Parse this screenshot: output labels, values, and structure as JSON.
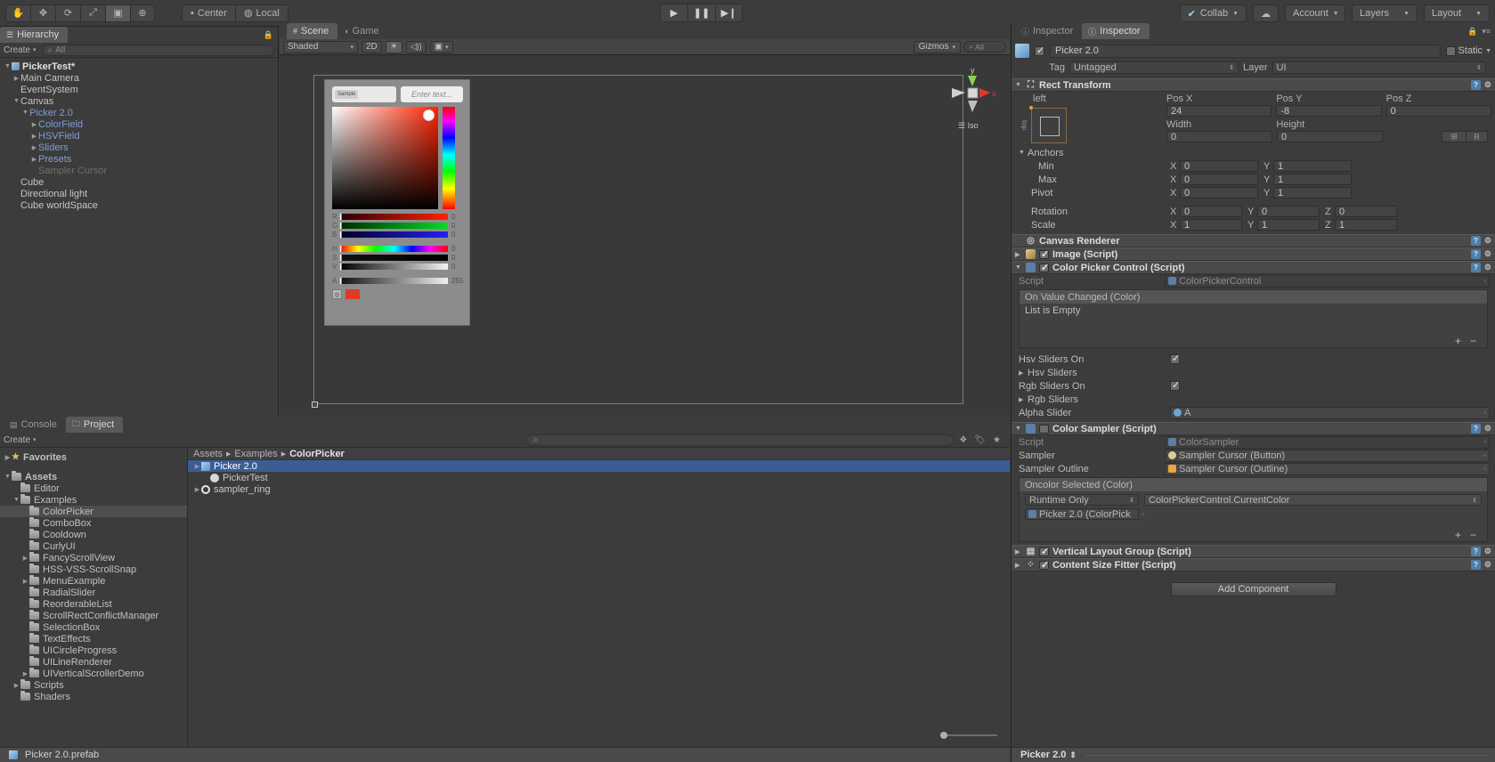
{
  "toolbar": {
    "tools": [
      {
        "name": "hand-tool",
        "glyph": "✋",
        "active": false
      },
      {
        "name": "move-tool",
        "glyph": "✥",
        "active": false
      },
      {
        "name": "rotate-tool",
        "glyph": "⟳",
        "active": false
      },
      {
        "name": "scale-tool",
        "glyph": "⤢",
        "active": false
      },
      {
        "name": "rect-tool",
        "glyph": "▣",
        "active": true
      },
      {
        "name": "transform-tool",
        "glyph": "⊕",
        "active": false
      }
    ],
    "pivot_label": "Center",
    "space_label": "Local",
    "play_label": "▶",
    "pause_label": "❚❚",
    "step_label": "▶❙",
    "collab_label": "Collab",
    "cloud_label": "☁",
    "account_label": "Account",
    "layers_label": "Layers",
    "layout_label": "Layout"
  },
  "hierarchy": {
    "tab_label": "Hierarchy",
    "create_label": "Create",
    "search_placeholder": "All",
    "items": [
      {
        "label": "PickerTest*",
        "depth": 0,
        "arrow": "down",
        "style": "root",
        "icon": "scene-icon"
      },
      {
        "label": "Main Camera",
        "depth": 1,
        "arrow": "right",
        "style": "normal",
        "icon": ""
      },
      {
        "label": "EventSystem",
        "depth": 1,
        "arrow": "none",
        "style": "normal",
        "icon": ""
      },
      {
        "label": "Canvas",
        "depth": 1,
        "arrow": "down",
        "style": "normal",
        "icon": ""
      },
      {
        "label": "Picker 2.0",
        "depth": 2,
        "arrow": "down",
        "style": "prefab",
        "icon": ""
      },
      {
        "label": "ColorField",
        "depth": 3,
        "arrow": "right",
        "style": "prefab",
        "icon": ""
      },
      {
        "label": "HSVField",
        "depth": 3,
        "arrow": "right",
        "style": "prefab",
        "icon": ""
      },
      {
        "label": "Sliders",
        "depth": 3,
        "arrow": "right",
        "style": "prefab",
        "icon": ""
      },
      {
        "label": "Presets",
        "depth": 3,
        "arrow": "right",
        "style": "prefab",
        "icon": ""
      },
      {
        "label": "Sampler Cursor",
        "depth": 3,
        "arrow": "none",
        "style": "faded",
        "icon": ""
      },
      {
        "label": "Cube",
        "depth": 1,
        "arrow": "none",
        "style": "normal",
        "icon": ""
      },
      {
        "label": "Directional light",
        "depth": 1,
        "arrow": "none",
        "style": "normal",
        "icon": ""
      },
      {
        "label": "Cube worldSpace",
        "depth": 1,
        "arrow": "none",
        "style": "normal",
        "icon": ""
      }
    ]
  },
  "scene": {
    "tab_scene": "Scene",
    "tab_game": "Game",
    "shading_mode": "Shaded",
    "mode_2d": "2D",
    "lighting_icon": "☀",
    "audio_icon": "🔊",
    "fx_icon": "▣",
    "gizmos_label": "Gizmos",
    "gizmo_search_placeholder": "All",
    "axis_labels": {
      "y": "y",
      "x": "x",
      "projection": "Iso"
    }
  },
  "picker": {
    "sample_label": "Sample",
    "input_placeholder": "Enter text...",
    "sliders": [
      {
        "label": "R",
        "value": "0",
        "track": "sld-r",
        "knob": 0
      },
      {
        "label": "G",
        "value": "0",
        "track": "sld-g",
        "knob": 0
      },
      {
        "label": "B",
        "value": "0",
        "track": "sld-b",
        "knob": 0
      },
      {
        "label": "H",
        "value": "0",
        "track": "sld-h",
        "knob": 0
      },
      {
        "label": "S",
        "value": "0",
        "track": "sld-s",
        "knob": 0
      },
      {
        "label": "V",
        "value": "0",
        "track": "sld-v",
        "knob": 0
      },
      {
        "label": "A",
        "value": "255",
        "track": "sld-a",
        "knob": 0
      }
    ],
    "swatch_color": "#e03a26"
  },
  "project": {
    "tab_console": "Console",
    "tab_project": "Project",
    "create_label": "Create",
    "breadcrumb": [
      "Assets",
      "Examples",
      "ColorPicker"
    ],
    "tree": [
      {
        "label": "Favorites",
        "depth": 0,
        "arrow": "right",
        "icon": "star",
        "bold": true,
        "selected": false
      },
      {
        "label": "",
        "depth": 0,
        "arrow": "none",
        "icon": "spacer",
        "bold": false,
        "selected": false
      },
      {
        "label": "Assets",
        "depth": 0,
        "arrow": "down",
        "icon": "folder",
        "bold": true,
        "selected": false
      },
      {
        "label": "Editor",
        "depth": 1,
        "arrow": "none",
        "icon": "folder",
        "bold": false,
        "selected": false
      },
      {
        "label": "Examples",
        "depth": 1,
        "arrow": "down",
        "icon": "folder",
        "bold": false,
        "selected": false
      },
      {
        "label": "ColorPicker",
        "depth": 2,
        "arrow": "none",
        "icon": "folder",
        "bold": false,
        "selected": true
      },
      {
        "label": "ComboBox",
        "depth": 2,
        "arrow": "none",
        "icon": "folder",
        "bold": false,
        "selected": false
      },
      {
        "label": "Cooldown",
        "depth": 2,
        "arrow": "none",
        "icon": "folder",
        "bold": false,
        "selected": false
      },
      {
        "label": "CurlyUI",
        "depth": 2,
        "arrow": "none",
        "icon": "folder",
        "bold": false,
        "selected": false
      },
      {
        "label": "FancyScrollView",
        "depth": 2,
        "arrow": "right",
        "icon": "folder",
        "bold": false,
        "selected": false
      },
      {
        "label": "HSS-VSS-ScrollSnap",
        "depth": 2,
        "arrow": "none",
        "icon": "folder",
        "bold": false,
        "selected": false
      },
      {
        "label": "MenuExample",
        "depth": 2,
        "arrow": "right",
        "icon": "folder",
        "bold": false,
        "selected": false
      },
      {
        "label": "RadialSlider",
        "depth": 2,
        "arrow": "none",
        "icon": "folder",
        "bold": false,
        "selected": false
      },
      {
        "label": "ReorderableList",
        "depth": 2,
        "arrow": "none",
        "icon": "folder",
        "bold": false,
        "selected": false
      },
      {
        "label": "ScrollRectConflictManager",
        "depth": 2,
        "arrow": "none",
        "icon": "folder",
        "bold": false,
        "selected": false
      },
      {
        "label": "SelectionBox",
        "depth": 2,
        "arrow": "none",
        "icon": "folder",
        "bold": false,
        "selected": false
      },
      {
        "label": "TextEffects",
        "depth": 2,
        "arrow": "none",
        "icon": "folder",
        "bold": false,
        "selected": false
      },
      {
        "label": "UICircleProgress",
        "depth": 2,
        "arrow": "none",
        "icon": "folder",
        "bold": false,
        "selected": false
      },
      {
        "label": "UILineRenderer",
        "depth": 2,
        "arrow": "none",
        "icon": "folder",
        "bold": false,
        "selected": false
      },
      {
        "label": "UIVerticalScrollerDemo",
        "depth": 2,
        "arrow": "right",
        "icon": "folder",
        "bold": false,
        "selected": false
      },
      {
        "label": "Scripts",
        "depth": 1,
        "arrow": "right",
        "icon": "folder",
        "bold": false,
        "selected": false
      },
      {
        "label": "Shaders",
        "depth": 1,
        "arrow": "none",
        "icon": "folder",
        "bold": false,
        "selected": false
      }
    ],
    "assets": [
      {
        "label": "Picker 2.0",
        "icon": "prefab",
        "arrow": "right",
        "selected": true,
        "indent": 0
      },
      {
        "label": "PickerTest",
        "icon": "scene",
        "arrow": "none",
        "selected": false,
        "indent": 1
      },
      {
        "label": "sampler_ring",
        "icon": "ring",
        "arrow": "right",
        "selected": false,
        "indent": 0
      }
    ],
    "footer_label": "Picker 2.0.prefab"
  },
  "inspector": {
    "tab_one": "Inspector",
    "tab_two": "Inspector",
    "object_name": "Picker 2.0",
    "static_label": "Static",
    "tag_label": "Tag",
    "tag_value": "Untagged",
    "layer_label": "Layer",
    "layer_value": "UI",
    "rect_transform": {
      "title": "Rect Transform",
      "anchor_preset": "left",
      "anchor_preset_side": "top",
      "headers": [
        "Pos X",
        "Pos Y",
        "Pos Z"
      ],
      "pos": [
        "24",
        "-8",
        "0"
      ],
      "size_headers": [
        "Width",
        "Height"
      ],
      "size": [
        "0",
        "0"
      ],
      "anchors_label": "Anchors",
      "min_label": "Min",
      "min": {
        "x": "0",
        "y": "1"
      },
      "max_label": "Max",
      "max": {
        "x": "0",
        "y": "1"
      },
      "pivot_label": "Pivot",
      "pivot": {
        "x": "0",
        "y": "1"
      },
      "rotation_label": "Rotation",
      "rotation": {
        "x": "0",
        "y": "0",
        "z": "0"
      },
      "scale_label": "Scale",
      "scale": {
        "x": "1",
        "y": "1",
        "z": "1"
      },
      "blueprint_label": "⊞",
      "raw_label": "R"
    },
    "canvas_renderer": {
      "title": "Canvas Renderer"
    },
    "image_component": {
      "title": "Image (Script)",
      "enabled": true
    },
    "color_picker_control": {
      "title": "Color Picker Control (Script)",
      "enabled": true,
      "script_label": "Script",
      "script_value": "ColorPickerControl",
      "event_title": "On Value Changed (Color)",
      "event_empty": "List is Empty",
      "props": [
        {
          "label": "Hsv Sliders On",
          "type": "checkbox",
          "value": true
        },
        {
          "label": "Hsv Sliders",
          "type": "foldout",
          "value": ""
        },
        {
          "label": "Rgb Sliders On",
          "type": "checkbox",
          "value": true
        },
        {
          "label": "Rgb Sliders",
          "type": "foldout",
          "value": ""
        },
        {
          "label": "Alpha Slider",
          "type": "object",
          "value": "A"
        }
      ]
    },
    "color_sampler": {
      "title": "Color Sampler (Script)",
      "enabled": false,
      "script_label": "Script",
      "script_value": "ColorSampler",
      "sampler_label": "Sampler",
      "sampler_value": "Sampler Cursor (Button)",
      "outline_label": "Sampler Outline",
      "outline_value": "Sampler Cursor (Outline)",
      "event_title": "Oncolor Selected (Color)",
      "event_mode": "Runtime Only",
      "event_function": "ColorPickerControl.CurrentColor",
      "event_target": "Picker 2.0 (ColorPick"
    },
    "vertical_layout_group": {
      "title": "Vertical Layout Group (Script)",
      "enabled": true
    },
    "content_size_fitter": {
      "title": "Content Size Fitter (Script)",
      "enabled": true
    },
    "add_component_label": "Add Component",
    "footer_label": "Picker 2.0"
  },
  "colors": {
    "selection_blue": "#3a5d94",
    "prefab_blue": "#7f9fd4",
    "panel_bg": "#3c3c3c",
    "header_bg": "#4a4a4a",
    "accent_red": "#e03a26"
  }
}
